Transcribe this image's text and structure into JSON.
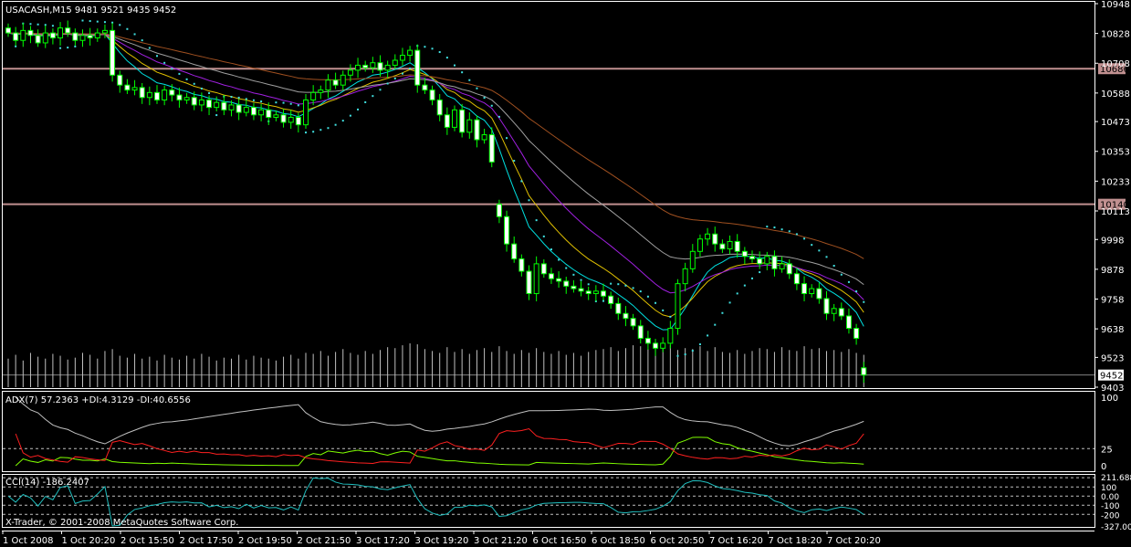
{
  "chart_data": {
    "type": "candlestick",
    "symbol_header": "USACASH,M15  9481 9521 9435 9452",
    "price_ticks": [
      10948,
      10828,
      10708,
      10588,
      10473,
      10353,
      10233,
      10113,
      9998,
      9878,
      9758,
      9638,
      9523,
      9403
    ],
    "ylim": [
      9403,
      10948
    ],
    "horizontal_lines": [
      {
        "value": 10686,
        "label": "10686",
        "color": "#c09090"
      },
      {
        "value": 10140,
        "label": "10140",
        "color": "#c09090"
      }
    ],
    "current_price": {
      "value": 9452,
      "label": "9452"
    },
    "time_labels": [
      "1 Oct 2008",
      "1 Oct 20:20",
      "2 Oct 15:50",
      "2 Oct 17:50",
      "2 Oct 19:50",
      "2 Oct 21:50",
      "3 Oct 17:20",
      "3 Oct 19:20",
      "3 Oct 21:20",
      "6 Oct 16:50",
      "6 Oct 18:50",
      "6 Oct 20:50",
      "7 Oct 16:20",
      "7 Oct 18:20",
      "7 Oct 20:20"
    ],
    "closes": [
      10830,
      10800,
      10840,
      10820,
      10790,
      10830,
      10810,
      10850,
      10830,
      10800,
      10820,
      10810,
      10830,
      10840,
      10660,
      10620,
      10600,
      10610,
      10570,
      10590,
      10560,
      10600,
      10580,
      10560,
      10570,
      10540,
      10560,
      10530,
      10550,
      10520,
      10540,
      10510,
      10530,
      10500,
      10520,
      10490,
      10500,
      10470,
      10490,
      10460,
      10560,
      10590,
      10600,
      10640,
      10620,
      10660,
      10680,
      10700,
      10690,
      10710,
      10680,
      10700,
      10720,
      10740,
      10760,
      10620,
      10600,
      10560,
      10500,
      10450,
      10520,
      10430,
      10480,
      10400,
      10420,
      10310,
      10090,
      9980,
      9920,
      9870,
      9780,
      9900,
      9860,
      9840,
      9830,
      9810,
      9800,
      9790,
      9780,
      9790,
      9770,
      9740,
      9700,
      9680,
      9650,
      9600,
      9580,
      9560,
      9580,
      9640,
      9820,
      9880,
      9950,
      10000,
      10020,
      9980,
      9960,
      9990,
      9950,
      9930,
      9920,
      9900,
      9930,
      9880,
      9900,
      9860,
      9820,
      9780,
      9800,
      9760,
      9700,
      9720,
      9690,
      9640,
      9600,
      9452
    ],
    "gap_opens": {
      "66": 10140,
      "115": 9481
    },
    "volumes": [
      30,
      34,
      28,
      36,
      32,
      30,
      35,
      33,
      29,
      31,
      36,
      34,
      30,
      38,
      40,
      33,
      31,
      35,
      30,
      32,
      28,
      34,
      31,
      29,
      33,
      30,
      35,
      32,
      28,
      31,
      30,
      34,
      29,
      33,
      31,
      30,
      28,
      32,
      34,
      30,
      36,
      35,
      38,
      33,
      37,
      40,
      36,
      34,
      38,
      35,
      39,
      42,
      41,
      44,
      46,
      45,
      40,
      38,
      36,
      42,
      37,
      40,
      35,
      39,
      41,
      37,
      43,
      38,
      35,
      39,
      36,
      41,
      37,
      35,
      38,
      34,
      36,
      33,
      37,
      39,
      40,
      42,
      38,
      41,
      44,
      43,
      40,
      45,
      42,
      44,
      39,
      41,
      40,
      43,
      38,
      42,
      37,
      36,
      39,
      35,
      38,
      41,
      40,
      37,
      42,
      39,
      38,
      43,
      40,
      41,
      38,
      39,
      37,
      40,
      36,
      34
    ],
    "moving_averages": [
      {
        "period": 8,
        "color": "#00e0e0"
      },
      {
        "period": 13,
        "color": "#e0c000"
      },
      {
        "period": 21,
        "color": "#a020e0"
      },
      {
        "period": 34,
        "color": "#a0a0a0"
      },
      {
        "period": 55,
        "color": "#a05020"
      }
    ],
    "psar": {
      "step": 0.02,
      "max": 0.2,
      "color": "#40e0e0"
    },
    "adx": {
      "label": "ADX(7) 57.2363  +DI:4.3129  -DI:40.6556",
      "period": 7,
      "ticks": [
        "100",
        "25",
        "0"
      ],
      "level": 25,
      "colors": {
        "adx": "#c0c0c0",
        "plus_di": "#80ff00",
        "minus_di": "#ff2020"
      }
    },
    "cci": {
      "label": "CCI(14) -186.2407",
      "period": 14,
      "ylim": [
        -327.007,
        211.688
      ],
      "ticks": [
        "211.688",
        "100",
        "0.00",
        "-100",
        "-200",
        "-327.007"
      ],
      "levels": [
        200,
        100,
        0,
        -100,
        -200
      ],
      "color": "#20c0c0"
    }
  },
  "copyright": "X-Trader, © 2001-2008 MetaQuotes Software Corp."
}
